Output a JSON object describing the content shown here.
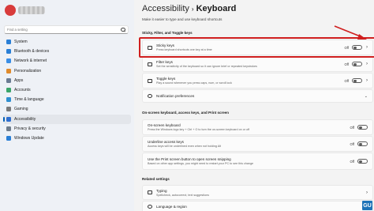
{
  "sidebar": {
    "search_placeholder": "Find a setting",
    "items": [
      {
        "label": "System",
        "icon": "system-icon",
        "color": "#2a7fd6"
      },
      {
        "label": "Bluetooth & devices",
        "icon": "bluetooth-icon",
        "color": "#2a7fd6"
      },
      {
        "label": "Network & internet",
        "icon": "network-icon",
        "color": "#3a8ee6"
      },
      {
        "label": "Personalization",
        "icon": "brush-icon",
        "color": "#e08a2b"
      },
      {
        "label": "Apps",
        "icon": "apps-icon",
        "color": "#6b7c93"
      },
      {
        "label": "Accounts",
        "icon": "accounts-icon",
        "color": "#3aa56a"
      },
      {
        "label": "Time & language",
        "icon": "time-icon",
        "color": "#2f8fd0"
      },
      {
        "label": "Gaming",
        "icon": "gaming-icon",
        "color": "#7a7a7a"
      },
      {
        "label": "Accessibility",
        "icon": "accessibility-icon",
        "color": "#2f6fcf"
      },
      {
        "label": "Privacy & security",
        "icon": "shield-icon",
        "color": "#6f7d8c"
      },
      {
        "label": "Windows Update",
        "icon": "update-icon",
        "color": "#2a7fd6"
      }
    ],
    "active_index": 8
  },
  "header": {
    "parent": "Accessibility",
    "separator": "›",
    "title": "Keyboard",
    "subtitle": "Make it easier to type and use keyboard shortcuts"
  },
  "sections": {
    "sticky": "Sticky, Filter, and Toggle keys",
    "onscreen": "On-screen keyboard, access keys, and Print screen",
    "related": "Related settings"
  },
  "rows": {
    "sticky": {
      "title": "Sticky keys",
      "desc": "Press keyboard shortcuts one key at a time",
      "state": "Off"
    },
    "filter": {
      "title": "Filter keys",
      "desc": "Set the sensitivity of the keyboard so it can ignore brief or repeated keystrokes",
      "state": "Off"
    },
    "toggle": {
      "title": "Toggle keys",
      "desc": "Play a sound whenever you press caps, num, or scroll lock",
      "state": "Off"
    },
    "notifications": {
      "title": "Notification preferences"
    },
    "onscreen": {
      "title": "On-screen keyboard",
      "desc": "Press the Windows logo key + Ctrl + O to turn the on-screen keyboard on or off",
      "state": "Off"
    },
    "underline": {
      "title": "Underline access keys",
      "desc": "Access keys will be underlined even when not holding Alt",
      "state": "Off"
    },
    "printscreen": {
      "title": "Use the Print screen button to open screen snipping",
      "desc": "Based on other app settings, you might need to restart your PC to see this change",
      "state": "Off"
    },
    "typing": {
      "title": "Typing",
      "desc": "Spellcheck, autocorrect, text suggestions"
    },
    "language": {
      "title": "Language & region"
    }
  },
  "colors": {
    "accent": "#005fb8",
    "highlight": "#d01f1f"
  },
  "logo": {
    "mark": "GU"
  }
}
